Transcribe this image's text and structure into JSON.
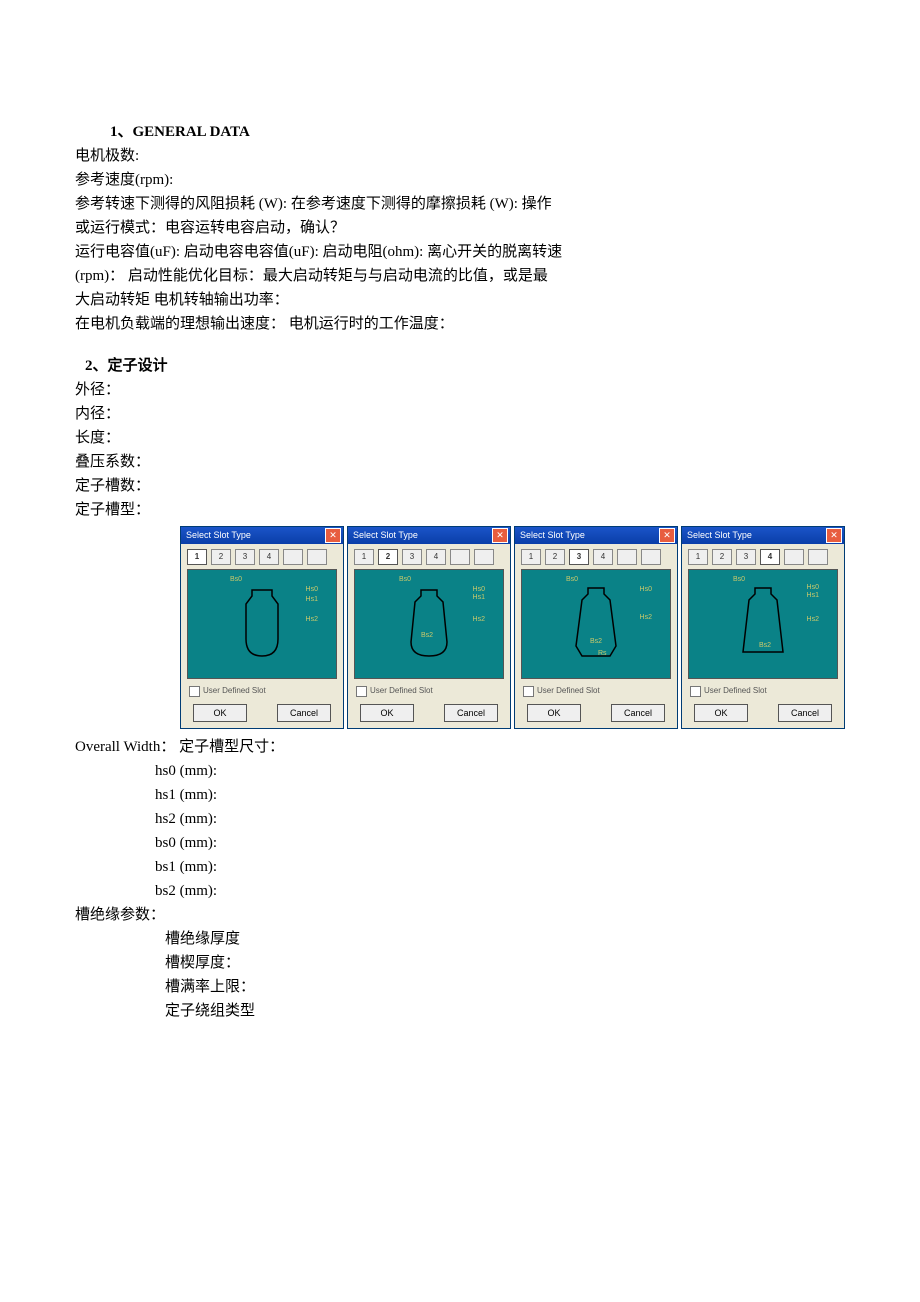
{
  "section1": {
    "heading": "1、GENERAL DATA",
    "lines": [
      "电机极数:",
      "参考速度(rpm):",
      "参考转速下测得的风阻损耗 (W): 在参考速度下测得的摩擦损耗 (W): 操作",
      "或运行模式：电容运转电容启动，确认？",
      "运行电容值(uF): 启动电容电容值(uF):  启动电阻(ohm): 离心开关的脱离转速",
      "(rpm)：  启动性能优化目标：最大启动转矩与与启动电流的比值，或是最",
      "大启动转矩  电机转轴输出功率：",
      "在电机负载端的理想输出速度：  电机运行时的工作温度："
    ]
  },
  "section2": {
    "heading": " 2、定子设计",
    "lines": [
      "外径：",
      "内径：",
      "长度：",
      "叠压系数：",
      "定子槽数：",
      "定子槽型："
    ]
  },
  "dialogs": {
    "title": "Select Slot Type",
    "tabs": [
      "1",
      "2",
      "3",
      "4",
      " ",
      " "
    ],
    "user_defined": "User Defined Slot",
    "ok": "OK",
    "cancel": "Cancel",
    "dim_labels": [
      "Bs0",
      "Hs0",
      "Hs1",
      "Hs2",
      "Bs2",
      "Rs"
    ]
  },
  "overall_width_line": "Overall Width：  定子槽型尺寸：",
  "dims": [
    "hs0 (mm):",
    "hs1 (mm):",
    "hs2 (mm):",
    "bs0 (mm):",
    "bs1 (mm):",
    "bs2 (mm):"
  ],
  "insulation": {
    "head": "槽绝缘参数：",
    "lines": [
      "槽绝缘厚度",
      "槽楔厚度：",
      "槽满率上限：",
      "定子绕组类型"
    ]
  }
}
